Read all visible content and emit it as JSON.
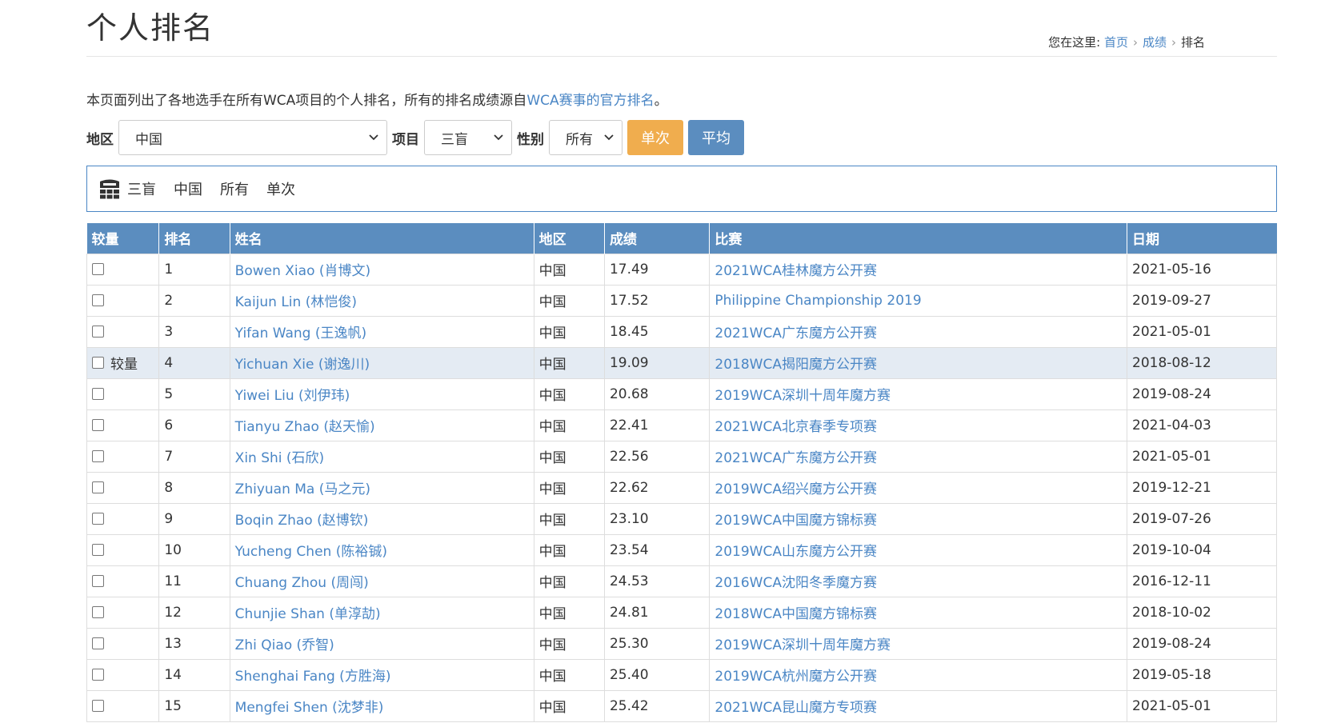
{
  "header": {
    "title": "个人排名",
    "breadcrumb_prefix": "您在这里:",
    "breadcrumb": [
      "首页",
      "成绩",
      "排名"
    ]
  },
  "intro": {
    "text_before": "本页面列出了各地选手在所有WCA项目的个人排名，所有的排名成绩源自",
    "link": "WCA赛事的官方排名",
    "text_after": "。"
  },
  "filters": {
    "region_label": "地区",
    "region_value": "中国",
    "event_label": "项目",
    "event_value": "三盲",
    "gender_label": "性别",
    "gender_value": "所有",
    "single_label": "单次",
    "average_label": "平均"
  },
  "summary": {
    "icon": "blindfold-3x3-icon",
    "event": "三盲",
    "region": "中国",
    "gender": "所有",
    "type": "单次"
  },
  "table": {
    "headers": [
      "较量",
      "排名",
      "姓名",
      "地区",
      "成绩",
      "比赛",
      "日期"
    ],
    "compare_hover_label": "较量",
    "rows": [
      {
        "rank": "1",
        "name": "Bowen Xiao (肖博文)",
        "region": "中国",
        "result": "17.49",
        "competition": "2021WCA桂林魔方公开赛",
        "date": "2021-05-16"
      },
      {
        "rank": "2",
        "name": "Kaijun Lin (林恺俊)",
        "region": "中国",
        "result": "17.52",
        "competition": "Philippine Championship 2019",
        "date": "2019-09-27"
      },
      {
        "rank": "3",
        "name": "Yifan Wang (王逸帆)",
        "region": "中国",
        "result": "18.45",
        "competition": "2021WCA广东魔方公开赛",
        "date": "2021-05-01"
      },
      {
        "rank": "4",
        "name": "Yichuan Xie (谢逸川)",
        "region": "中国",
        "result": "19.09",
        "competition": "2018WCA揭阳魔方公开赛",
        "date": "2018-08-12"
      },
      {
        "rank": "5",
        "name": "Yiwei Liu (刘伊玮)",
        "region": "中国",
        "result": "20.68",
        "competition": "2019WCA深圳十周年魔方赛",
        "date": "2019-08-24"
      },
      {
        "rank": "6",
        "name": "Tianyu Zhao (赵天愉)",
        "region": "中国",
        "result": "22.41",
        "competition": "2021WCA北京春季专项赛",
        "date": "2021-04-03"
      },
      {
        "rank": "7",
        "name": "Xin Shi (石欣)",
        "region": "中国",
        "result": "22.56",
        "competition": "2021WCA广东魔方公开赛",
        "date": "2021-05-01"
      },
      {
        "rank": "8",
        "name": "Zhiyuan Ma (马之元)",
        "region": "中国",
        "result": "22.62",
        "competition": "2019WCA绍兴魔方公开赛",
        "date": "2019-12-21"
      },
      {
        "rank": "9",
        "name": "Boqin Zhao (赵博钦)",
        "region": "中国",
        "result": "23.10",
        "competition": "2019WCA中国魔方锦标赛",
        "date": "2019-07-26"
      },
      {
        "rank": "10",
        "name": "Yucheng Chen (陈裕铖)",
        "region": "中国",
        "result": "23.54",
        "competition": "2019WCA山东魔方公开赛",
        "date": "2019-10-04"
      },
      {
        "rank": "11",
        "name": "Chuang Zhou (周闯)",
        "region": "中国",
        "result": "24.53",
        "competition": "2016WCA沈阳冬季魔方赛",
        "date": "2016-12-11"
      },
      {
        "rank": "12",
        "name": "Chunjie Shan (单淳劼)",
        "region": "中国",
        "result": "24.81",
        "competition": "2018WCA中国魔方锦标赛",
        "date": "2018-10-02"
      },
      {
        "rank": "13",
        "name": "Zhi Qiao (乔智)",
        "region": "中国",
        "result": "25.30",
        "competition": "2019WCA深圳十周年魔方赛",
        "date": "2019-08-24"
      },
      {
        "rank": "14",
        "name": "Shenghai Fang (方胜海)",
        "region": "中国",
        "result": "25.40",
        "competition": "2019WCA杭州魔方公开赛",
        "date": "2019-05-18"
      },
      {
        "rank": "15",
        "name": "Mengfei Shen (沈梦非)",
        "region": "中国",
        "result": "25.42",
        "competition": "2021WCA昆山魔方专项赛",
        "date": "2021-05-01"
      }
    ]
  },
  "colors": {
    "link": "#4a86c5",
    "header_bg": "#5b8dbf",
    "single_button": "#f0ad4e",
    "average_button": "#5b8dbf",
    "highlight_row": "#e4ebf3"
  }
}
